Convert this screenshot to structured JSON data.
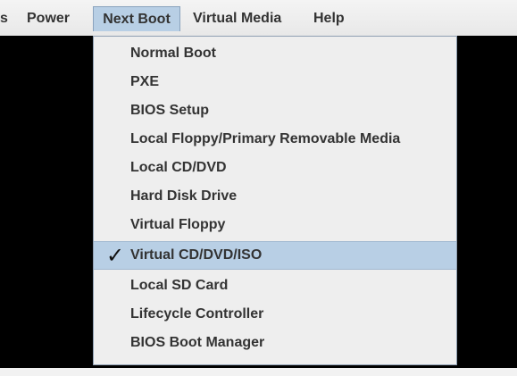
{
  "menubar": {
    "cut_item": "s",
    "power": "Power",
    "next_boot": "Next Boot",
    "virtual_media": "Virtual Media",
    "help": "Help"
  },
  "dropdown": {
    "items": [
      {
        "label": "Normal Boot",
        "checked": false
      },
      {
        "label": "PXE",
        "checked": false
      },
      {
        "label": "BIOS Setup",
        "checked": false
      },
      {
        "label": "Local Floppy/Primary Removable Media",
        "checked": false
      },
      {
        "label": "Local CD/DVD",
        "checked": false
      },
      {
        "label": "Hard Disk Drive",
        "checked": false
      },
      {
        "label": "Virtual Floppy",
        "checked": false
      },
      {
        "label": "Virtual CD/DVD/ISO",
        "checked": true
      },
      {
        "label": "Local SD Card",
        "checked": false
      },
      {
        "label": "Lifecycle Controller",
        "checked": false
      },
      {
        "label": "BIOS Boot Manager",
        "checked": false
      }
    ],
    "check_glyph": "✓"
  },
  "colors": {
    "menubar_bg": "#ececec",
    "selected_bg": "#b8cfe5",
    "dropdown_bg": "#eeeeee",
    "canvas_bg": "#000000",
    "text": "#333333"
  }
}
